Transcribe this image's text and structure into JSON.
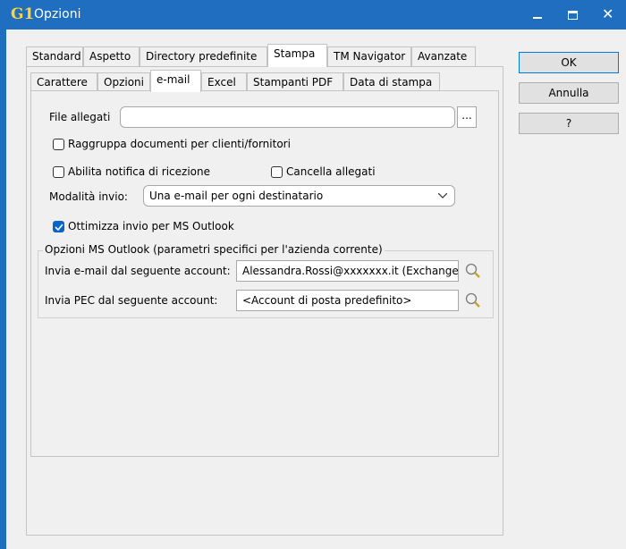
{
  "window": {
    "app_logo": "G1",
    "title": "Opzioni"
  },
  "main_tabs": [
    {
      "label": "Standard"
    },
    {
      "label": "Aspetto"
    },
    {
      "label": "Directory predefinite"
    },
    {
      "label": "Stampa"
    },
    {
      "label": "TM Navigator"
    },
    {
      "label": "Avanzate"
    }
  ],
  "sub_tabs": [
    {
      "label": "Carattere"
    },
    {
      "label": "Opzioni"
    },
    {
      "label": "e-mail"
    },
    {
      "label": "Excel"
    },
    {
      "label": "Stampanti PDF"
    },
    {
      "label": "Data di stampa"
    }
  ],
  "buttons": {
    "ok": "OK",
    "cancel": "Annulla",
    "help": "?"
  },
  "form": {
    "attachments_label": "File allegati",
    "attachments_value": "",
    "browse_label": "...",
    "group_docs_label": "Raggruppa documenti per clienti/fornitori",
    "receipt_label": "Abilita notifica di ricezione",
    "delete_attachments_label": "Cancella allegati",
    "send_mode_label": "Modalità invio:",
    "send_mode_value": "Una e-mail per ogni destinatario",
    "outlook_opt_label": "Ottimizza invio per MS Outlook",
    "outlook_group_title": "Opzioni MS Outlook (parametri specifici per l'azienda corrente)",
    "account_label": "Invia e-mail dal seguente account:",
    "account_value": "Alessandra.Rossi@xxxxxxx.it (Exchange",
    "pec_label": "Invia PEC dal seguente account:",
    "pec_value": "<Account di posta predefinito>"
  },
  "checks": {
    "group_docs": false,
    "receipt": false,
    "delete_attachments": false,
    "outlook_opt": true
  }
}
